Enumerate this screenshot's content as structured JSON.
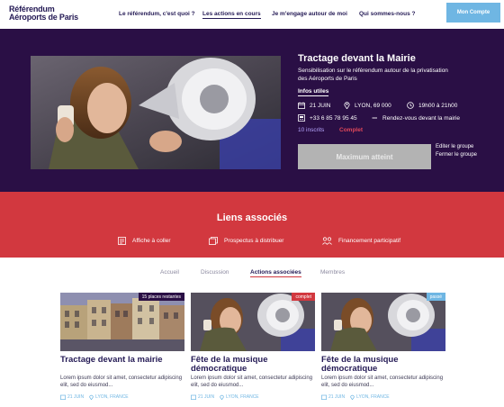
{
  "header": {
    "logo_line1": "Référendum",
    "logo_line2": "Aéroports de Paris",
    "nav": [
      {
        "label": "Le référendum, c'est quoi ?"
      },
      {
        "label": "Les actions en cours"
      },
      {
        "label": "Je m'engage autour de moi"
      },
      {
        "label": "Qui sommes-nous ?"
      }
    ],
    "account_button": "Mon Compte"
  },
  "event": {
    "title": "Tractage devant la Mairie",
    "description": "Sensibilisation sur le référendum autour de la privatisation des Aéroports de Paris",
    "infos_title": "Infos utiles",
    "date": "21 JUIN",
    "location": "LYON, 69 000",
    "time": "19h00 à 21h00",
    "phone": "+33 6 85 78 95 45",
    "meeting": "Rendez-vous devant la mairie",
    "registered": "10 inscrits",
    "status": "Complet",
    "max_button": "Maximum atteint",
    "edit_group": "Editer le groupe",
    "close_group": "Fermer le groupe"
  },
  "liens": {
    "title": "Liens associés",
    "items": [
      {
        "label": "Affiche à coller",
        "icon": "poster-icon"
      },
      {
        "label": "Prospectus à distribuer",
        "icon": "flyer-icon"
      },
      {
        "label": "Financement participatif",
        "icon": "crowdfunding-icon"
      }
    ]
  },
  "tabs": [
    {
      "label": "Accueil"
    },
    {
      "label": "Discussion"
    },
    {
      "label": "Actions associées"
    },
    {
      "label": "Membres"
    }
  ],
  "cards": [
    {
      "badge": "15 places restantes",
      "title": "Tractage devant la mairie",
      "excerpt": "Lorem ipsum dolor sit amet, consectetur adipiscing elit, sed do eiusmod...",
      "date": "21 JUIN",
      "location": "LYON, FRANCE"
    },
    {
      "badge": "complet",
      "title": "Fête de la musique démocratique",
      "excerpt": "Lorem ipsum dolor sit amet, consectetur adipiscing elit, sed do eiusmod...",
      "date": "21 JUIN",
      "location": "LYON, FRANCE"
    },
    {
      "badge": "passé",
      "title": "Fête de la musique démocratique",
      "excerpt": "Lorem ipsum dolor sit amet, consectetur adipiscing elit, sed do eiusmod...",
      "date": "21 JUIN",
      "location": "LYON, FRANCE"
    }
  ],
  "colors": {
    "navy": "#241a55",
    "hero_bg": "#2a0f45",
    "red": "#d2383f",
    "blue": "#6fb6e3",
    "grey_button": "#b3b3b3",
    "badge_available": "#2a0f45",
    "badge_complet": "#d2383f",
    "badge_passe": "#6fb6e3"
  }
}
